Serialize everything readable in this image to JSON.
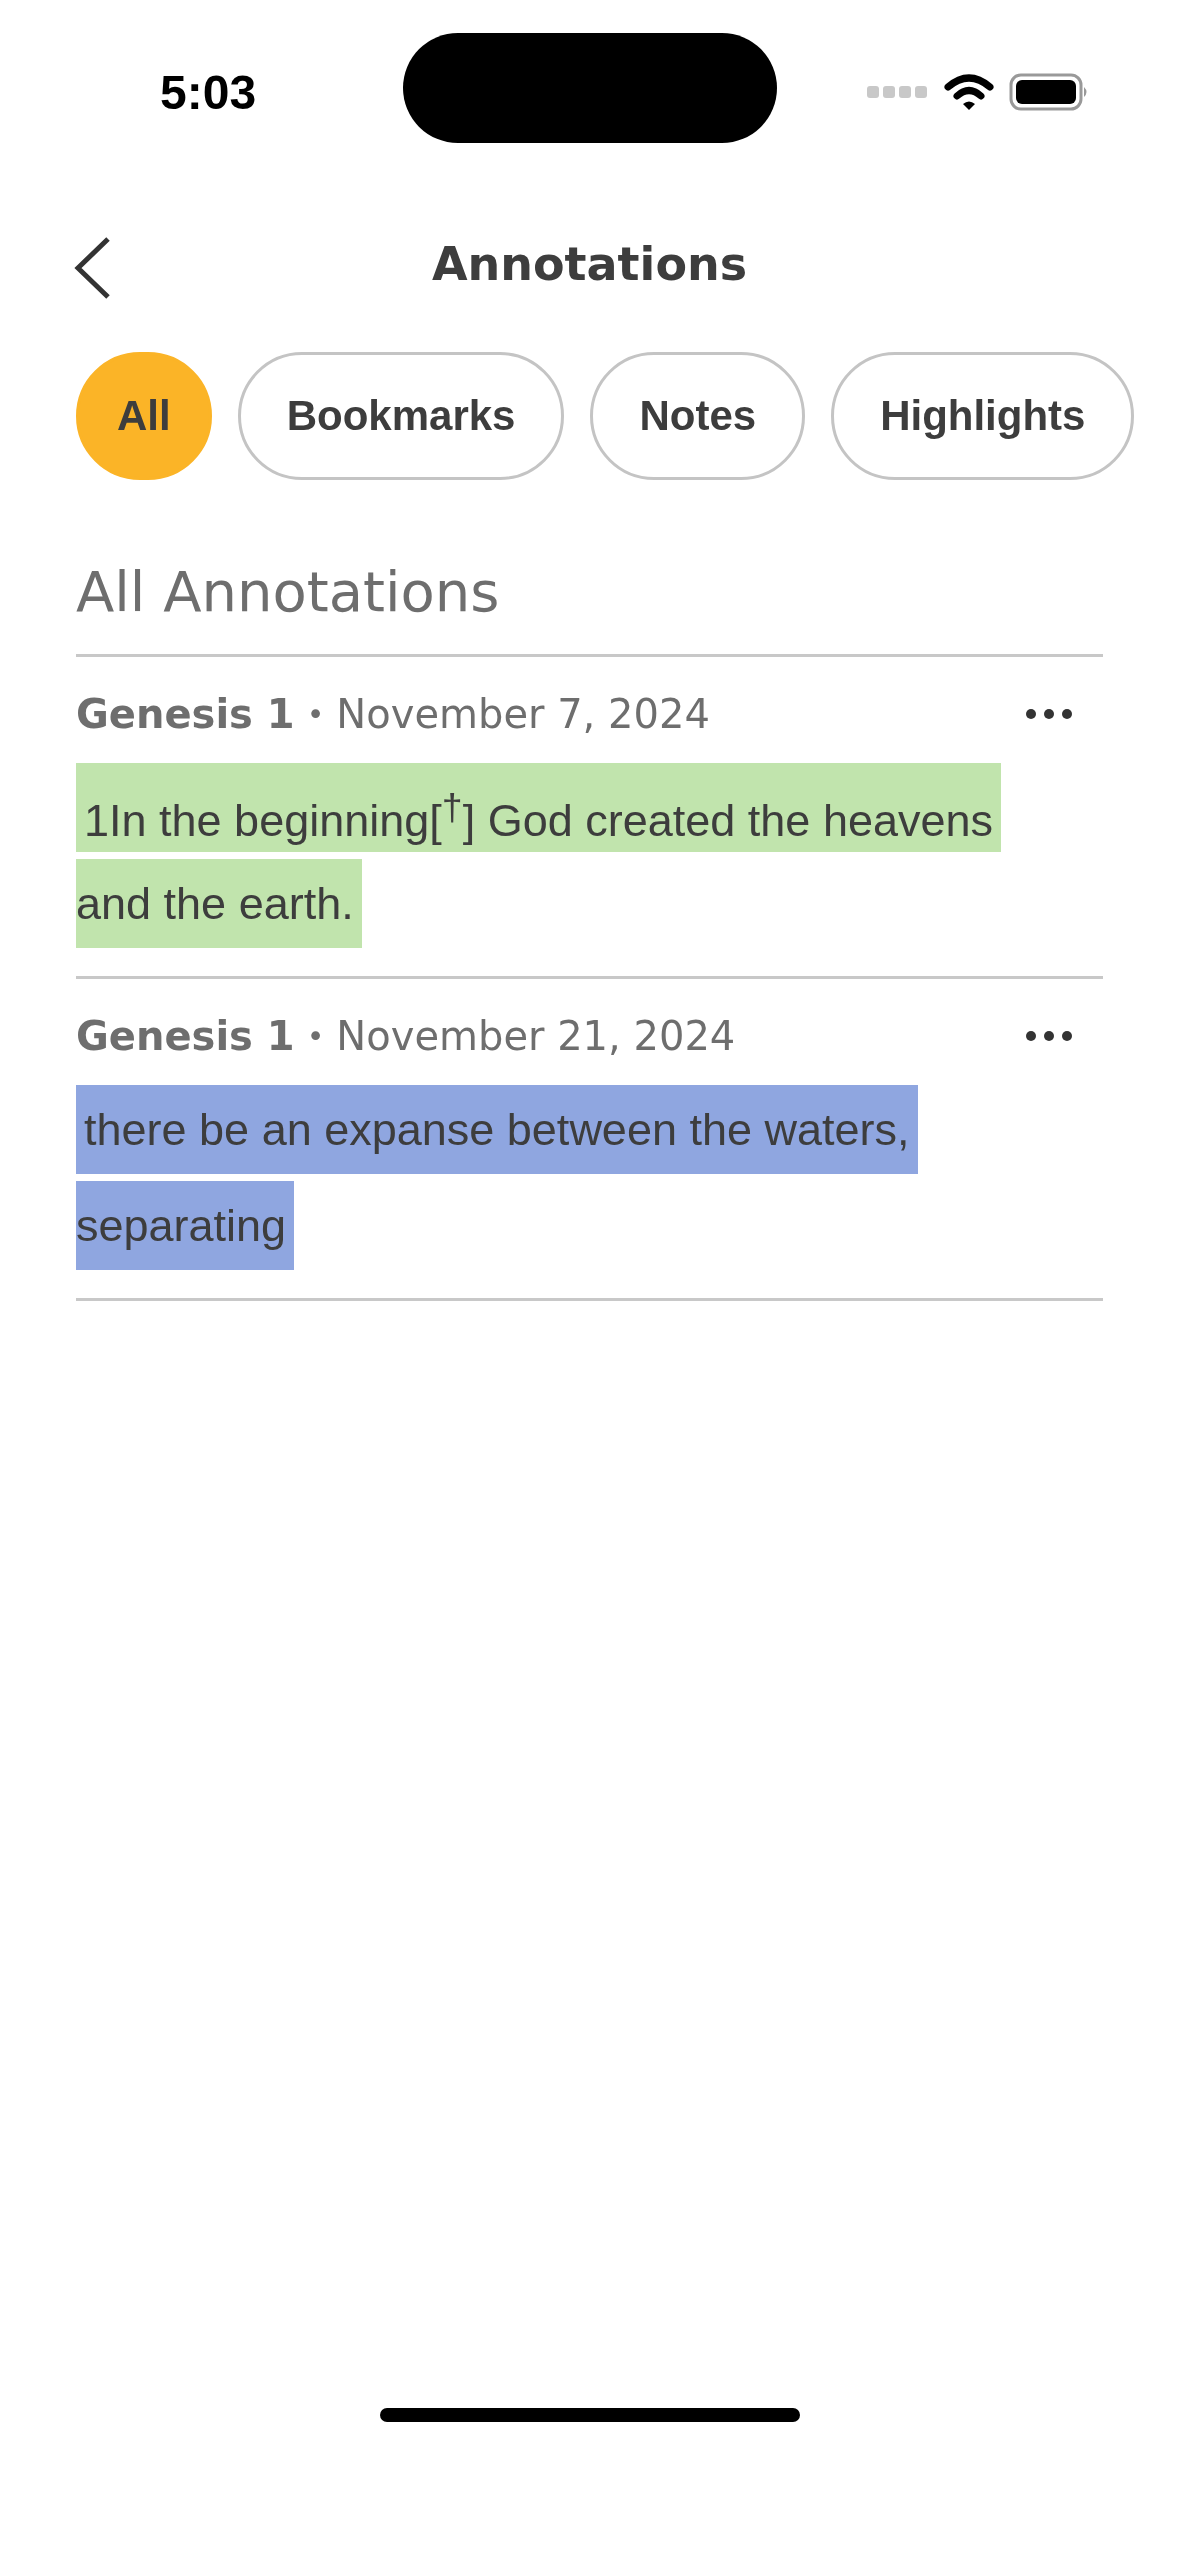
{
  "status_bar": {
    "time": "5:03"
  },
  "nav": {
    "title": "Annotations"
  },
  "filters": [
    {
      "label": "All",
      "selected": true
    },
    {
      "label": "Bookmarks",
      "selected": false
    },
    {
      "label": "Notes",
      "selected": false
    },
    {
      "label": "Highlights",
      "selected": false
    }
  ],
  "section_title": "All Annotations",
  "annotations": [
    {
      "book": "Genesis 1",
      "separator": "•",
      "date": "November 7, 2024",
      "lines": [
        "1In the beginning[$^{†}$] God created the heavens",
        "and the earth."
      ],
      "color": "#c1e4ad"
    },
    {
      "book": "Genesis 1",
      "separator": "•",
      "date": "November 21, 2024",
      "lines": [
        "there be an expanse between the waters,",
        "separating"
      ],
      "color": "#8fa6e0"
    }
  ]
}
